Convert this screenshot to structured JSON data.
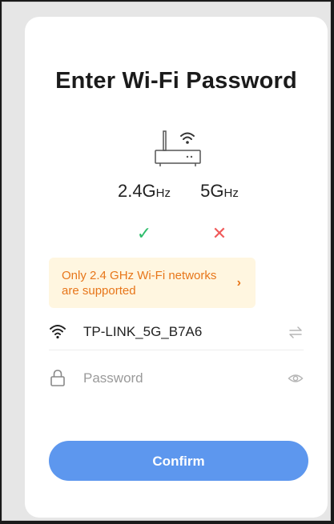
{
  "page": {
    "title": "Enter Wi-Fi Password"
  },
  "bands": [
    {
      "label_main": "2.4G",
      "label_unit": "Hz",
      "status": "supported",
      "status_glyph": "✓"
    },
    {
      "label_main": "5G",
      "label_unit": "Hz",
      "status": "unsupported",
      "status_glyph": "✕"
    }
  ],
  "notice": {
    "text": "Only 2.4 GHz Wi-Fi networks are supported",
    "chevron": "›"
  },
  "ssid": {
    "value": "TP-LINK_5G_B7A6",
    "icon": "wifi-icon",
    "action_icon": "switch-network-icon"
  },
  "password": {
    "placeholder": "Password",
    "value": "",
    "icon": "lock-icon",
    "action_icon": "eye-icon"
  },
  "confirm_label": "Confirm",
  "colors": {
    "accent": "#5d97ee",
    "success": "#2ebd6b",
    "error": "#f05a5a",
    "warning_text": "#e7761a",
    "warning_bg": "#fff6e0"
  }
}
